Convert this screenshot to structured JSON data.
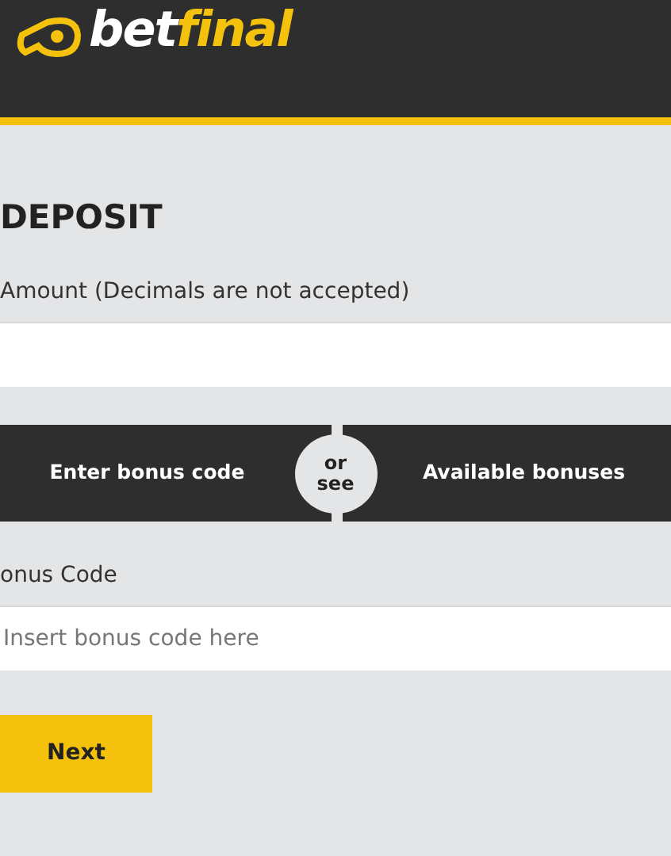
{
  "header": {
    "logo": {
      "part_1": "bet",
      "part_2": "final"
    }
  },
  "title": "DEPOSIT",
  "amount": {
    "label": "Amount (Decimals are not accepted)"
  },
  "bonus_switch": {
    "left": "Enter bonus code",
    "separator": [
      "or",
      "see"
    ],
    "right": "Available bonuses"
  },
  "bonus_code": {
    "label": "onus Code",
    "placeholder": "Insert bonus code here"
  },
  "buttons": [
    "Next"
  ]
}
